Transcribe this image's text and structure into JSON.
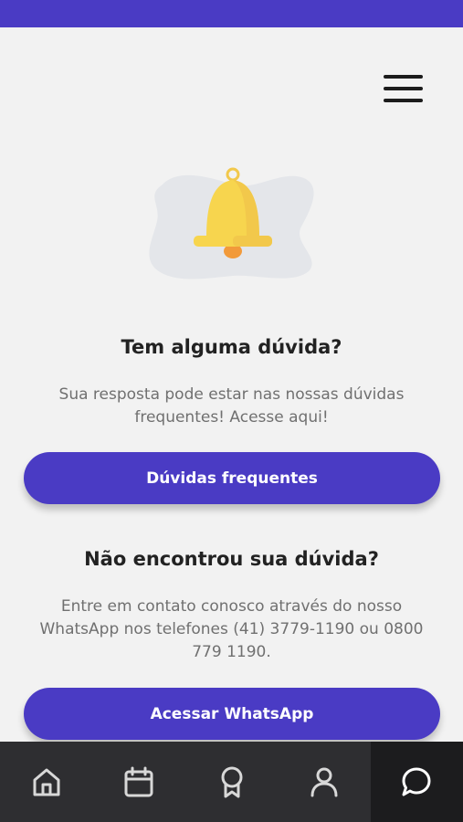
{
  "theme": {
    "accent": "#4a3bc4",
    "nav_background": "#2e2e31",
    "nav_active_background": "#1c1c1e",
    "bell_color": "#f7d54e"
  },
  "header": {
    "menu_icon": "hamburger-menu-icon"
  },
  "illustration": {
    "icon": "bell-icon"
  },
  "faq_section": {
    "title": "Tem alguma dúvida?",
    "description": "Sua resposta pode estar nas nossas dúvidas frequentes! Acesse aqui!",
    "button_label": "Dúvidas frequentes"
  },
  "contact_section": {
    "title": "Não encontrou sua dúvida?",
    "description": "Entre em contato conosco através do nosso WhatsApp nos telefones (41) 3779-1190 ou 0800 779 1190.",
    "button_label": "Acessar WhatsApp"
  },
  "bottom_nav": {
    "items": [
      {
        "icon": "home-icon",
        "active": false
      },
      {
        "icon": "calendar-icon",
        "active": false
      },
      {
        "icon": "award-ribbon-icon",
        "active": false
      },
      {
        "icon": "user-icon",
        "active": false
      },
      {
        "icon": "chat-bubble-icon",
        "active": true
      }
    ]
  }
}
